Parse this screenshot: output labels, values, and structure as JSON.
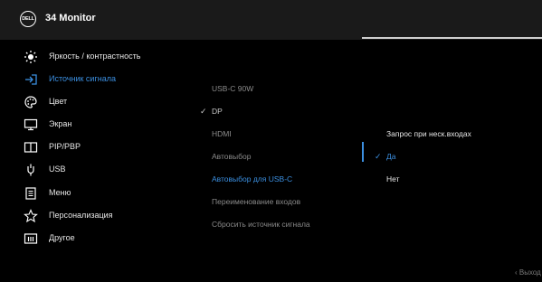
{
  "header": {
    "logo_text": "DELL",
    "title": "34 Monitor"
  },
  "sidebar": {
    "items": [
      {
        "label": "Яркость / контрастность",
        "icon": "brightness-icon"
      },
      {
        "label": "Источник сигнала",
        "icon": "input-source-icon",
        "active": true
      },
      {
        "label": "Цвет",
        "icon": "color-palette-icon"
      },
      {
        "label": "Экран",
        "icon": "display-icon"
      },
      {
        "label": "PIP/PBP",
        "icon": "pip-pbp-icon"
      },
      {
        "label": "USB",
        "icon": "usb-icon"
      },
      {
        "label": "Меню",
        "icon": "menu-icon"
      },
      {
        "label": "Персонализация",
        "icon": "star-icon"
      },
      {
        "label": "Другое",
        "icon": "info-icon"
      }
    ]
  },
  "submenu": {
    "items": [
      {
        "label": "USB-C 90W"
      },
      {
        "label": "DP",
        "selected": true
      },
      {
        "label": "HDMI"
      },
      {
        "label": "Автовыбор"
      },
      {
        "label": "Автовыбор для USB-C",
        "active": true
      },
      {
        "label": "Переименование входов"
      },
      {
        "label": "Сбросить  источник сигнала"
      }
    ]
  },
  "options": {
    "items": [
      {
        "label": "Запрос при неск.входах"
      },
      {
        "label": "Да",
        "selected": true,
        "active": true
      },
      {
        "label": "Нет"
      }
    ]
  },
  "footer": {
    "exit_label": "Выход"
  },
  "colors": {
    "accent": "#3b8fe0",
    "background": "#000000",
    "header": "#1a1a1a"
  }
}
